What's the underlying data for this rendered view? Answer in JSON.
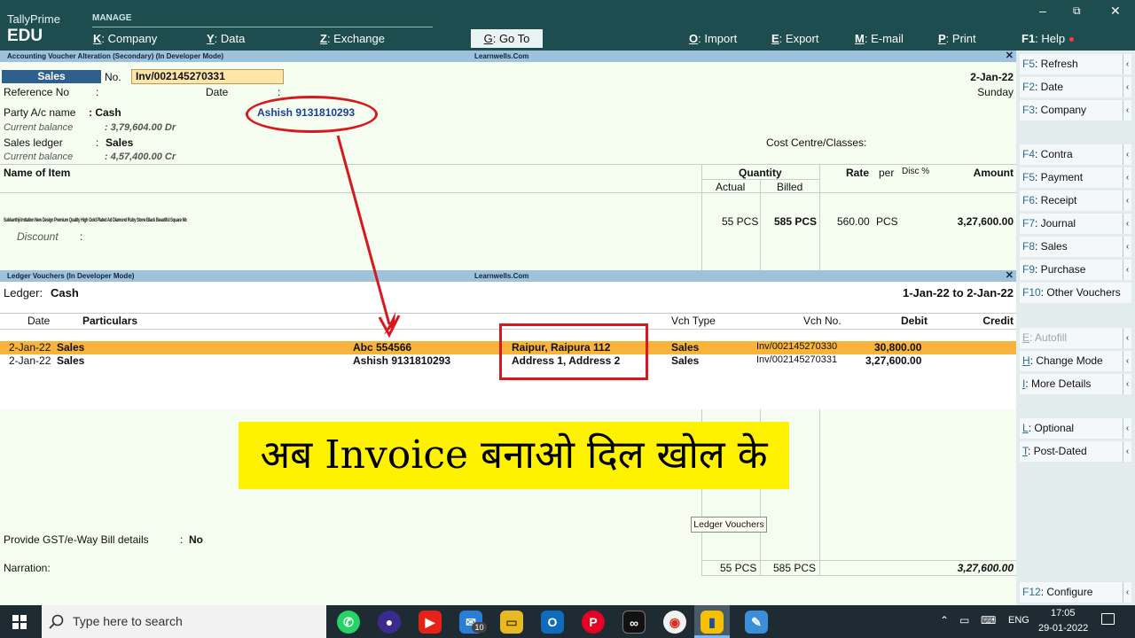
{
  "topbar": {
    "brand_line1": "TallyPrime",
    "brand_line2": "EDU",
    "section": "MANAGE",
    "menu": [
      {
        "key": "K",
        "label": ": Company"
      },
      {
        "key": "Y",
        "label": ": Data"
      },
      {
        "key": "Z",
        "label": ": Exchange"
      },
      {
        "key": "G",
        "label": ": Go To"
      },
      {
        "key": "O",
        "label": ": Import"
      },
      {
        "key": "E",
        "label": ": Export"
      },
      {
        "key": "M",
        "label": ": E-mail"
      },
      {
        "key": "P",
        "label": ": Print"
      },
      {
        "key": "F1",
        "label": ": Help"
      }
    ],
    "window_controls": [
      "–",
      "⧉",
      "✕"
    ]
  },
  "voucher": {
    "strip_left": "Accounting Voucher Alteration (Secondary) (In Developer Mode)",
    "strip_center": "Learnwells.Com",
    "close": "✕",
    "type": "Sales",
    "no_label": "No.",
    "no_value": "Inv/002145270331",
    "date": "2-Jan-22",
    "day": "Sunday",
    "reference_label": "Reference No",
    "date_label": "Date",
    "colon": ":",
    "party_label": "Party A/c name",
    "party_value": ": Cash",
    "party_annotation": "Ashish 9131810293",
    "current_balance_label": "Current balance",
    "party_balance": ": 3,79,604.00 Dr",
    "sales_ledger_label": "Sales ledger",
    "sales_ledger_value": "Sales",
    "sales_balance": ": 4,57,400.00 Cr",
    "cost_centre_label": "Cost Centre/Classes:",
    "columns": {
      "name": "Name of Item",
      "quantity": "Quantity",
      "actual": "Actual",
      "billed": "Billed",
      "rate": "Rate",
      "per": "per",
      "disc": "Disc %",
      "amount": "Amount"
    },
    "item": {
      "name": "Sukkanthji Imitation New Design Premium Quality High Gold Plated Ad Diamond Ruby Stone Black Beautiful Square Mc",
      "actual": "55 PCS",
      "billed": "585 PCS",
      "rate": "560.00",
      "per": "PCS",
      "amount": "3,27,600.00"
    },
    "discount_label": "Discount",
    "gst_label": "Provide GST/e-Way Bill details",
    "gst_value": "No",
    "narration_label": "Narration:",
    "total_actual": "55 PCS",
    "total_billed": "585 PCS",
    "total_amount": "3,27,600.00"
  },
  "ledger": {
    "strip_left": "Ledger Vouchers (In Developer Mode)",
    "strip_center": "Learnwells.Com",
    "close": "✕",
    "ledger_label": "Ledger:",
    "ledger_value": "Cash",
    "period": "1-Jan-22 to 2-Jan-22",
    "columns": {
      "date": "Date",
      "particulars": "Particulars",
      "vch_type": "Vch Type",
      "vch_no": "Vch No.",
      "debit": "Debit",
      "credit": "Credit"
    },
    "rows": [
      {
        "date": "2-Jan-22",
        "particulars": "Sales",
        "name": "Abc 554566",
        "address": "Raipur, Raipura 112",
        "vch_type": "Sales",
        "vch_no": "Inv/002145270330",
        "debit": "30,800.00"
      },
      {
        "date": "2-Jan-22",
        "particulars": "Sales",
        "name": "Ashish 9131810293",
        "address": "Address 1, Address 2",
        "vch_type": "Sales",
        "vch_no": "Inv/002145270331",
        "debit": "3,27,600.00"
      }
    ]
  },
  "banner_text": "अब Invoice बनाओ दिल खोल के",
  "tooltip": "Ledger Vouchers",
  "sidebar": [
    {
      "key": "F5",
      "label": ": Refresh",
      "arrow": true,
      "disabled": false
    },
    {
      "key": "F2",
      "label": ": Date",
      "arrow": true,
      "disabled": false
    },
    {
      "key": "F3",
      "label": ": Company",
      "arrow": true,
      "disabled": false
    },
    {
      "key": "F4",
      "label": ": Contra",
      "arrow": true,
      "disabled": false
    },
    {
      "key": "F5",
      "label": ": Payment",
      "arrow": true,
      "disabled": false
    },
    {
      "key": "F6",
      "label": ": Receipt",
      "arrow": true,
      "disabled": false
    },
    {
      "key": "F7",
      "label": ": Journal",
      "arrow": true,
      "disabled": false
    },
    {
      "key": "F8",
      "label": ": Sales",
      "arrow": true,
      "disabled": false
    },
    {
      "key": "F9",
      "label": ": Purchase",
      "arrow": true,
      "disabled": false
    },
    {
      "key": "F10",
      "label": ": Other Vouchers",
      "arrow": false,
      "disabled": false
    },
    {
      "key": "E",
      "label": ": Autofill",
      "arrow": true,
      "disabled": true
    },
    {
      "key": "H",
      "label": ": Change Mode",
      "arrow": true,
      "disabled": false
    },
    {
      "key": "I",
      "label": ": More Details",
      "arrow": true,
      "disabled": false
    },
    {
      "key": "L",
      "label": ": Optional",
      "arrow": true,
      "disabled": false
    },
    {
      "key": "T",
      "label": ": Post-Dated",
      "arrow": true,
      "disabled": false
    },
    {
      "key": "F12",
      "label": ": Configure",
      "arrow": true,
      "disabled": false
    }
  ],
  "taskbar": {
    "search_placeholder": "Type here to search",
    "mail_badge": "10",
    "language": "ENG",
    "time": "17:05",
    "date": "29-01-2022"
  },
  "colors": {
    "topbar": "#1d4d4f",
    "strip": "#9ec2dc",
    "highlight_row": "#f7b33b",
    "annotation": "#d7191f",
    "banner": "#fff200"
  }
}
